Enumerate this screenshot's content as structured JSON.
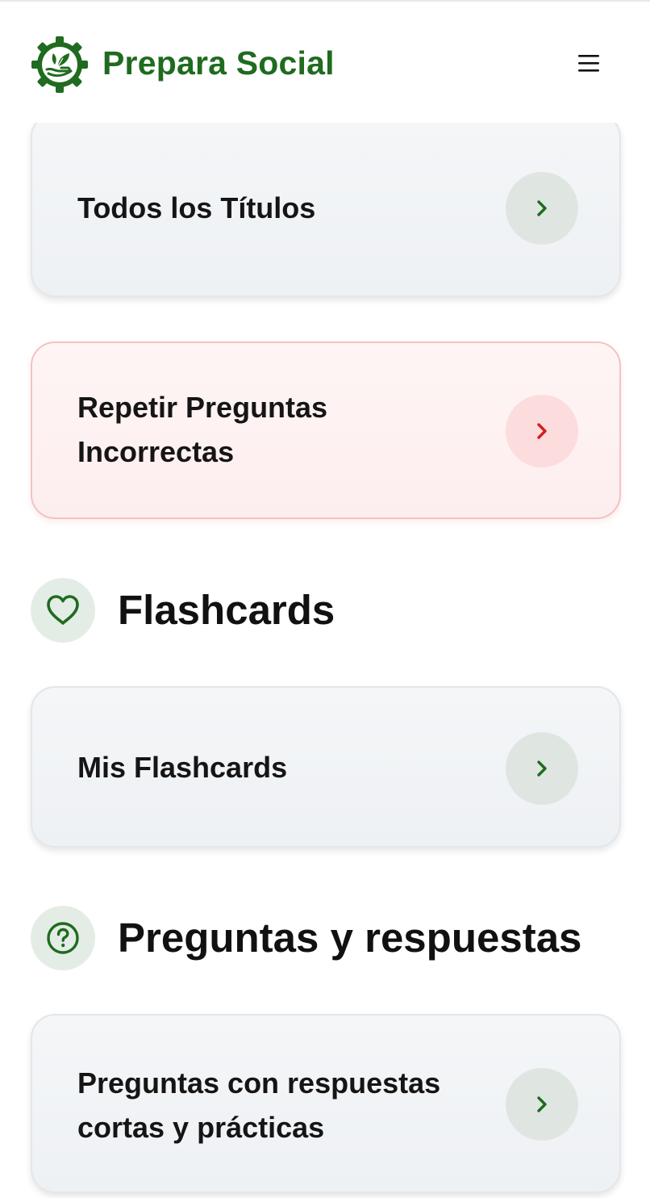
{
  "header": {
    "brand": "Prepara Social",
    "logo_icon": "gear-hand-leaf-icon",
    "menu_icon": "hamburger-menu-icon"
  },
  "colors": {
    "brand_green": "#1f6b1f",
    "danger_red": "#d11f1f",
    "card_bg": "#f1f4f7",
    "danger_card_bg": "#fdf0f0"
  },
  "cards": [
    {
      "label": "Todos los Títulos",
      "icon": "chevron-right-icon"
    },
    {
      "label_line1": "Repetir Preguntas",
      "label_line2": "Incorrectas",
      "icon": "chevron-right-icon",
      "variant": "danger"
    }
  ],
  "sections": [
    {
      "title": "Flashcards",
      "icon": "heart-icon",
      "cards": [
        {
          "label": "Mis Flashcards",
          "icon": "chevron-right-icon"
        }
      ]
    },
    {
      "title": "Preguntas y respuestas",
      "icon": "question-circle-icon",
      "cards": [
        {
          "label_line1": "Preguntas con respuestas",
          "label_line2": "cortas y prácticas",
          "icon": "chevron-right-icon"
        }
      ]
    }
  ]
}
